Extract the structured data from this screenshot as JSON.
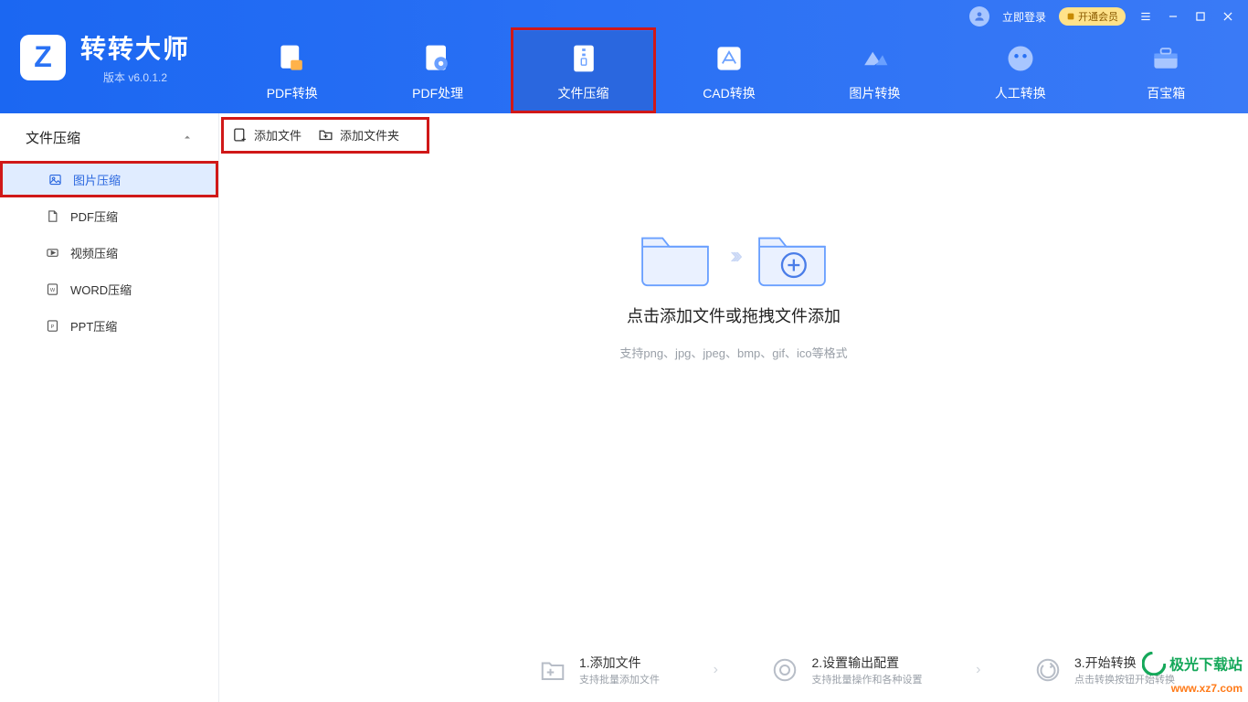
{
  "header": {
    "app_name": "转转大师",
    "version": "版本 v6.0.1.2",
    "login": "立即登录",
    "vip": "开通会员"
  },
  "nav": [
    {
      "label": "PDF转换"
    },
    {
      "label": "PDF处理"
    },
    {
      "label": "文件压缩"
    },
    {
      "label": "CAD转换"
    },
    {
      "label": "图片转换"
    },
    {
      "label": "人工转换"
    },
    {
      "label": "百宝箱"
    }
  ],
  "sidebar": {
    "title": "文件压缩",
    "items": [
      {
        "label": "图片压缩"
      },
      {
        "label": "PDF压缩"
      },
      {
        "label": "视频压缩"
      },
      {
        "label": "WORD压缩"
      },
      {
        "label": "PPT压缩"
      }
    ]
  },
  "toolbar": {
    "add_file": "添加文件",
    "add_folder": "添加文件夹"
  },
  "drop": {
    "title": "点击添加文件或拖拽文件添加",
    "subtitle": "支持png、jpg、jpeg、bmp、gif、ico等格式"
  },
  "steps": [
    {
      "title": "1.添加文件",
      "sub": "支持批量添加文件"
    },
    {
      "title": "2.设置输出配置",
      "sub": "支持批量操作和各种设置"
    },
    {
      "title": "3.开始转换",
      "sub": "点击转换按钮开始转换"
    }
  ],
  "watermark": {
    "line1": "极光下载站",
    "line2": "www.xz7.com"
  }
}
